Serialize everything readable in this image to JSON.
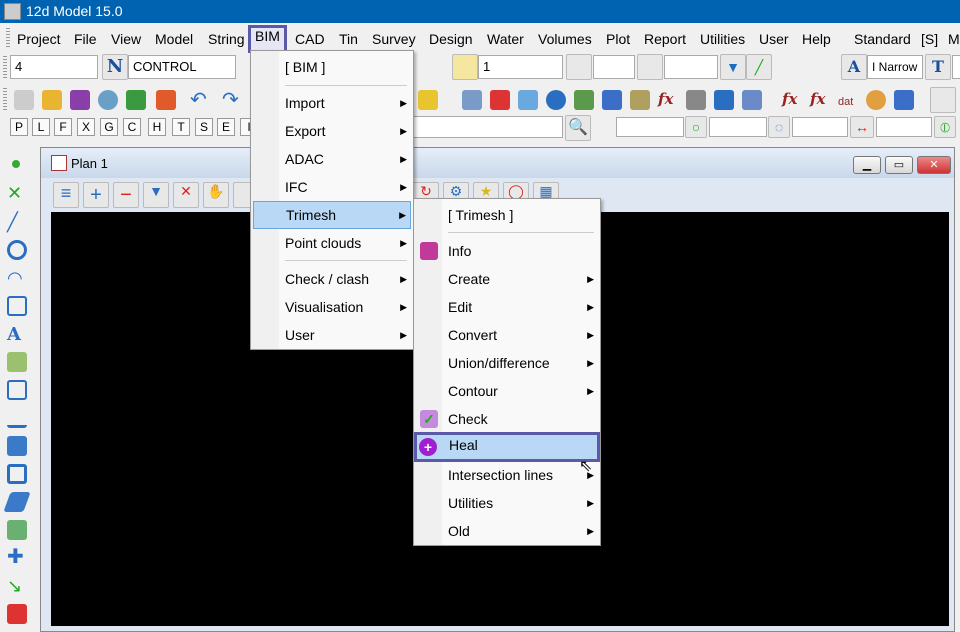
{
  "window": {
    "title": "12d Model 15.0"
  },
  "menubar": [
    "Project",
    "File",
    "View",
    "Model",
    "String",
    "BIM",
    "CAD",
    "Tin",
    "Survey",
    "Design",
    "Water",
    "Volumes",
    "Plot",
    "Report",
    "Utilities",
    "User",
    "Help",
    "Standard",
    "[S]",
    "M"
  ],
  "toolbar": {
    "field1": "4",
    "name_field": "CONTROL",
    "z_field": "1",
    "font_field": "I Narrow"
  },
  "lock_buttons": [
    "P",
    "L",
    "F",
    "X",
    "G",
    "C",
    "H",
    "T",
    "S",
    "E",
    "I"
  ],
  "plan": {
    "title": "Plan 1"
  },
  "bim_menu": {
    "header": "[ BIM ]",
    "items": [
      "Import",
      "Export",
      "ADAC",
      "IFC",
      "Trimesh",
      "Point clouds",
      "Check / clash",
      "Visualisation",
      "User"
    ]
  },
  "trimesh_menu": {
    "header": "[ Trimesh ]",
    "items": [
      "Info",
      "Create",
      "Edit",
      "Convert",
      "Union/difference",
      "Contour",
      "Check",
      "Heal",
      "Intersection lines",
      "Utilities",
      "Old"
    ]
  },
  "colors": {
    "titlebar": "#0063b1",
    "highlight": "#b8d8f5",
    "focus_border": "#5a5aa8"
  }
}
